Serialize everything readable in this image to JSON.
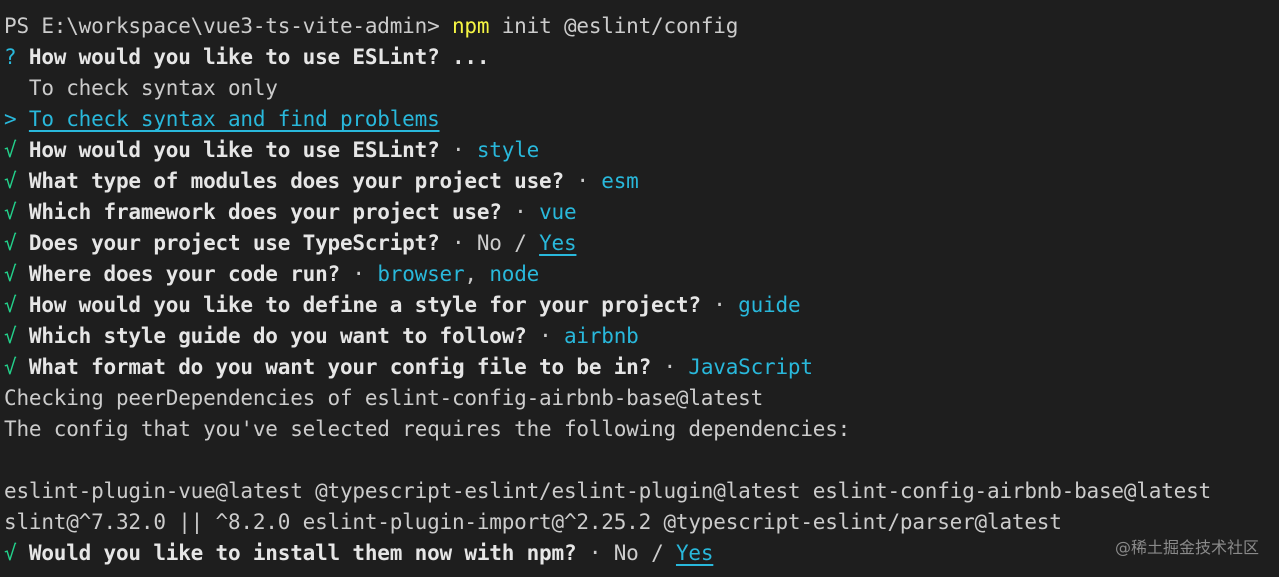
{
  "prompt": {
    "ps": "PS E:\\workspace\\vue3-ts-vite-admin> ",
    "cmd_npm": "npm",
    "cmd_rest": " init @eslint/config"
  },
  "q_use": {
    "mark": "? ",
    "question": "How would you like to use ESLint?",
    "suffix": " ..."
  },
  "options": {
    "opt1": "  To check syntax only",
    "pointer": "> ",
    "opt2": "To check syntax and find problems"
  },
  "answers": [
    {
      "mark": "√ ",
      "q": "How would you like to use ESLint?",
      "sep": " · ",
      "a": "style"
    },
    {
      "mark": "√ ",
      "q": "What type of modules does your project use?",
      "sep": " · ",
      "a": "esm"
    },
    {
      "mark": "√ ",
      "q": "Which framework does your project use?",
      "sep": " · ",
      "a": "vue"
    }
  ],
  "ts": {
    "mark": "√ ",
    "q": "Does your project use TypeScript?",
    "sep": " · ",
    "no": "No",
    "slash": " / ",
    "yes": "Yes"
  },
  "run": {
    "mark": "√ ",
    "q": "Where does your code run?",
    "sep": " · ",
    "a1": "browser",
    "comma": ", ",
    "a2": "node"
  },
  "answers2": [
    {
      "mark": "√ ",
      "q": "How would you like to define a style for your project?",
      "sep": " · ",
      "a": "guide"
    },
    {
      "mark": "√ ",
      "q": "Which style guide do you want to follow?",
      "sep": " · ",
      "a": "airbnb"
    },
    {
      "mark": "√ ",
      "q": "What format do you want your config file to be in?",
      "sep": " · ",
      "a": "JavaScript"
    }
  ],
  "output": {
    "checking": "Checking peerDependencies of eslint-config-airbnb-base@latest",
    "requires": "The config that you've selected requires the following dependencies:",
    "deps1": "eslint-plugin-vue@latest @typescript-eslint/eslint-plugin@latest eslint-config-airbnb-base@latest",
    "deps2": "slint@^7.32.0 || ^8.2.0 eslint-plugin-import@^2.25.2 @typescript-eslint/parser@latest"
  },
  "install": {
    "mark": "√ ",
    "q": "Would you like to install them now with npm?",
    "sep": " · ",
    "no": "No",
    "slash": " / ",
    "yes": "Yes"
  },
  "watermark": "@稀土掘金技术社区",
  "colors": {
    "background": "#1e1e1e",
    "foreground": "#cccccc",
    "cyan": "#29b8db",
    "yellow": "#f5f543",
    "green": "#23d18b"
  }
}
